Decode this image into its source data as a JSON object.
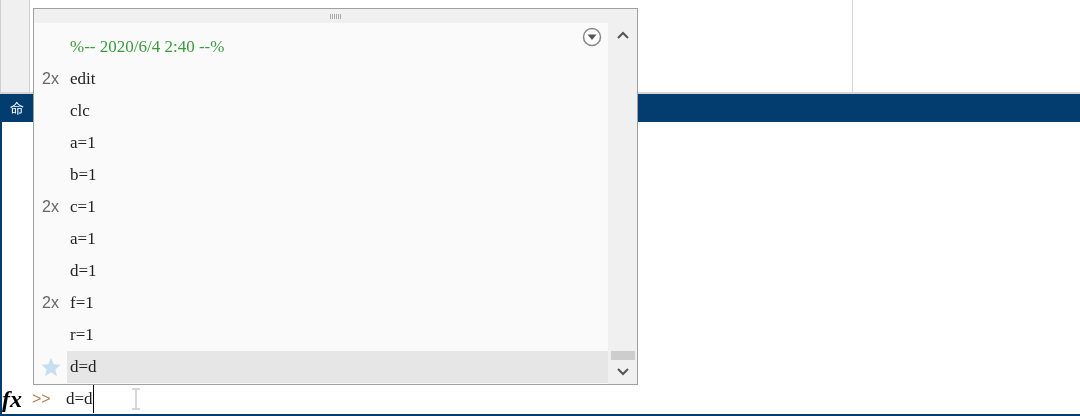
{
  "command_window": {
    "title": "命",
    "function_browser": "fx",
    "prompt": ">>",
    "input_value": "d=d"
  },
  "history_popup": {
    "entries": [
      {
        "kind": "timestamp",
        "text": "%-- 2020/6/4 2:40 --%",
        "selected": false
      },
      {
        "kind": "command",
        "text": "edit",
        "count": "2x",
        "selected": false
      },
      {
        "kind": "command",
        "text": "clc",
        "selected": false
      },
      {
        "kind": "command",
        "text": "a=1",
        "selected": false
      },
      {
        "kind": "command",
        "text": "b=1",
        "selected": false
      },
      {
        "kind": "command",
        "text": "c=1",
        "count": "2x",
        "selected": false
      },
      {
        "kind": "command",
        "text": "a=1",
        "selected": false
      },
      {
        "kind": "command",
        "text": "d=1",
        "selected": false
      },
      {
        "kind": "command",
        "text": "f=1",
        "count": "2x",
        "selected": false
      },
      {
        "kind": "command",
        "text": "r=1",
        "selected": false
      },
      {
        "kind": "command",
        "text": "d=d",
        "selected": true
      }
    ]
  }
}
